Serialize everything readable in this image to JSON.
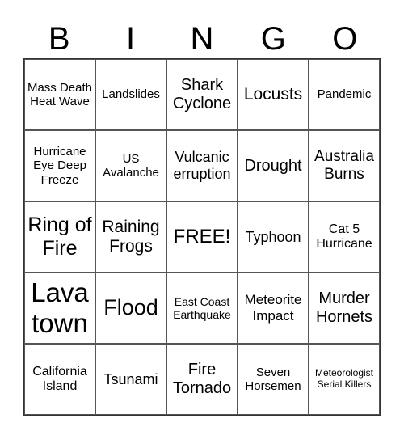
{
  "header": {
    "letters": [
      "B",
      "I",
      "N",
      "G",
      "O"
    ]
  },
  "cells": [
    {
      "text": "Mass Death Heat Wave",
      "size": 15
    },
    {
      "text": "Landslides",
      "size": 15
    },
    {
      "text": "Shark Cyclone",
      "size": 20
    },
    {
      "text": "Locusts",
      "size": 21
    },
    {
      "text": "Pandemic",
      "size": 15
    },
    {
      "text": "Hurricane Eye Deep Freeze",
      "size": 15
    },
    {
      "text": "US Avalanche",
      "size": 15
    },
    {
      "text": "Vulcanic erruption",
      "size": 18
    },
    {
      "text": "Drought",
      "size": 20
    },
    {
      "text": "Australia Burns",
      "size": 19
    },
    {
      "text": "Ring of Fire",
      "size": 25
    },
    {
      "text": "Raining Frogs",
      "size": 21
    },
    {
      "text": "FREE!",
      "size": 24
    },
    {
      "text": "Typhoon",
      "size": 18
    },
    {
      "text": "Cat 5 Hurricane",
      "size": 16
    },
    {
      "text": "Lava town",
      "size": 33
    },
    {
      "text": "Flood",
      "size": 27
    },
    {
      "text": "East Coast Earthquake",
      "size": 14
    },
    {
      "text": "Meteorite Impact",
      "size": 17
    },
    {
      "text": "Murder Hornets",
      "size": 20
    },
    {
      "text": "California Island",
      "size": 16
    },
    {
      "text": "Tsunami",
      "size": 18
    },
    {
      "text": "Fire Tornado",
      "size": 20
    },
    {
      "text": "Seven Horsemen",
      "size": 15
    },
    {
      "text": "Meteorologist Serial Killers",
      "size": 12
    }
  ]
}
